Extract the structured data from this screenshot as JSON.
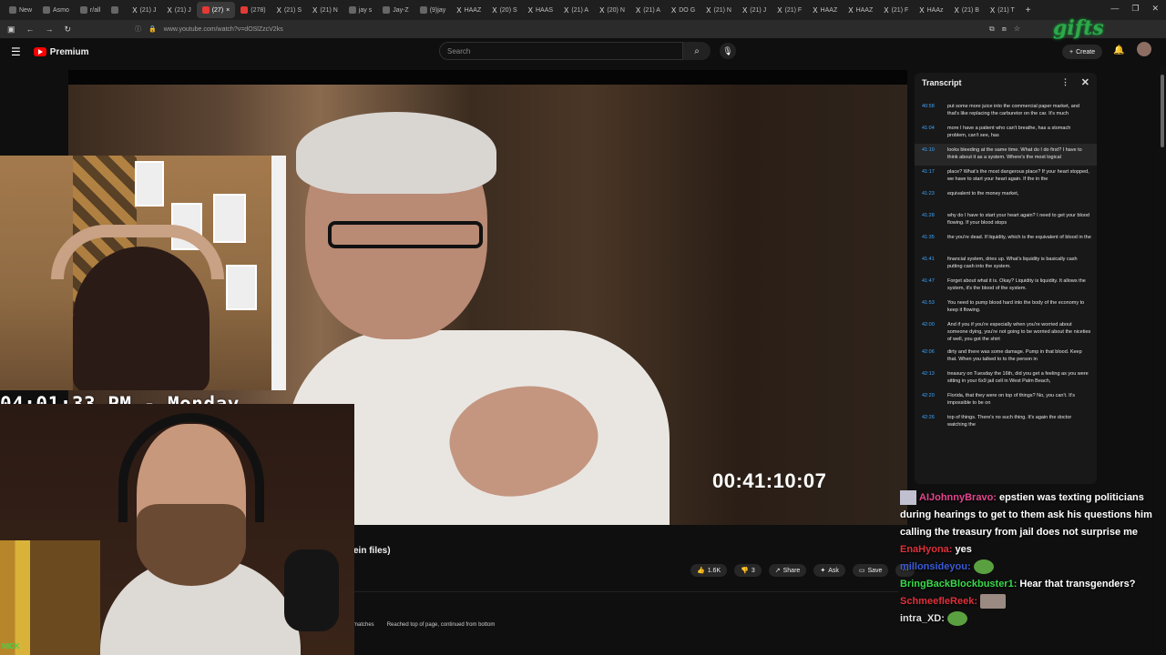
{
  "browser": {
    "tabs": [
      {
        "label": "New",
        "icon": "chrome-icon"
      },
      {
        "label": "Asmo",
        "icon": "reddit-icon"
      },
      {
        "label": "r/all",
        "icon": "reddit-icon"
      },
      {
        "label": "",
        "icon": "page-icon"
      },
      {
        "label": "(21) J",
        "icon": "x-icon"
      },
      {
        "label": "(21) J",
        "icon": "x-icon"
      },
      {
        "label": "(27)",
        "icon": "youtube-icon",
        "active": true
      },
      {
        "label": "(278)",
        "icon": "youtube-icon"
      },
      {
        "label": "(21) S",
        "icon": "x-icon"
      },
      {
        "label": "(21) N",
        "icon": "x-icon"
      },
      {
        "label": "jay s",
        "icon": "google-icon"
      },
      {
        "label": "Jay-Z",
        "icon": "page-icon"
      },
      {
        "label": "(9)jay",
        "icon": "instagram-icon"
      },
      {
        "label": "HAAZ",
        "icon": "x-icon"
      },
      {
        "label": "(20) S",
        "icon": "x-icon"
      },
      {
        "label": "HAAS",
        "icon": "x-icon"
      },
      {
        "label": "(21) A",
        "icon": "x-icon"
      },
      {
        "label": "(20) N",
        "icon": "x-icon"
      },
      {
        "label": "(21) A",
        "icon": "x-icon"
      },
      {
        "label": "DO G",
        "icon": "x-icon"
      },
      {
        "label": "(21) N",
        "icon": "x-icon"
      },
      {
        "label": "(21) J",
        "icon": "x-icon"
      },
      {
        "label": "(21) F",
        "icon": "x-icon"
      },
      {
        "label": "HAAZ",
        "icon": "x-icon"
      },
      {
        "label": "HAAZ",
        "icon": "x-icon"
      },
      {
        "label": "(21) F",
        "icon": "x-icon"
      },
      {
        "label": "HAAz",
        "icon": "x-icon"
      },
      {
        "label": "(21) B",
        "icon": "x-icon"
      },
      {
        "label": "(21) T",
        "icon": "x-icon"
      }
    ],
    "url": "www.youtube.com/watch?v=dOSlZzcV2ks"
  },
  "youtube": {
    "logo_text": "Premium",
    "search_placeholder": "Search",
    "create_label": "Create"
  },
  "video": {
    "timecode": "00:41:10:07",
    "title_fragment": "ein files)",
    "likes": "1.6K",
    "dislikes": "3",
    "share_label": "Share",
    "ask_label": "Ask",
    "save_label": "Save",
    "find_matches": "matches",
    "find_status": "Reached top of page, continued from bottom"
  },
  "transcript": {
    "title": "Transcript",
    "segments": [
      {
        "time": "40:58",
        "text": "put some more juice into the commercial paper market, and that's like replacing the carburetor on the car. It's much"
      },
      {
        "time": "41:04",
        "text": "more I have a patient who can't breathe, has a stomach problem, can't see, has"
      },
      {
        "time": "41:10",
        "text": "looks bleeding at the same time. What do I do first? I have to think about it as a system. Where's the most logical",
        "active": true
      },
      {
        "time": "41:17",
        "text": "place? What's the most dangerous place? If your heart stopped, we have to start your heart again. If the in the"
      },
      {
        "time": "41:23",
        "text": "equivalent to the money market,"
      },
      {
        "time": "41:28",
        "text": "why do I have to start your heart again? I need to get your blood flowing. If your blood stops"
      },
      {
        "time": "41:35",
        "text": "the you're dead. If liquidity, which is the equivalent of blood in the"
      },
      {
        "time": "41:41",
        "text": "financial system, dries up. What's liquidity is basically cash putting cash into the system."
      },
      {
        "time": "41:47",
        "text": "Forget about what it is. Okay? Liquidity is liquidity. It allows the system, it's the blood of the system."
      },
      {
        "time": "41:53",
        "text": "You need to pump blood hard into the body of the economy to keep it flowing."
      },
      {
        "time": "42:00",
        "text": "And if you if you're especially when you're worried about someone dying, you're not going to be worried about the niceties of well, you got the shirt"
      },
      {
        "time": "42:06",
        "text": "dirty and there was some damage. Pump in that blood. Keep that. When you talked to to the person in"
      },
      {
        "time": "42:13",
        "text": "treasury on Tuesday the 16th, did you get a feeling as you were sitting in your 6x9 jail cell in West Palm Beach,"
      },
      {
        "time": "42:20",
        "text": "Florida, that they were on top of things? No, you can't. It's impossible to be on"
      },
      {
        "time": "42:26",
        "text": "top of things. There's no such thing. It's again the doctor watching the"
      }
    ]
  },
  "overlay": {
    "clock": "04:01:33 PM - Monday",
    "cam_tag": "NICK",
    "logo_text": "gifts"
  },
  "chat": [
    {
      "user": "AIJohnnyBravo:",
      "color": "#e5468f",
      "text": "epstien was texting politicians during hearings to get to them ask his questions him calling the treasury from jail does not surprise me",
      "badge": true
    },
    {
      "user": "EnaHyona:",
      "color": "#e0303a",
      "text": "yes"
    },
    {
      "user": "millonsideyou:",
      "color": "#3b5bd6",
      "text": "",
      "emote": "frog-emote"
    },
    {
      "user": "BringBackBlockbuster1:",
      "color": "#3ad84a",
      "text": "Hear that transgenders?"
    },
    {
      "user": "SchmeefleReek:",
      "color": "#e0303a",
      "text": "",
      "emote": "image-emote"
    },
    {
      "user": "intra_XD:",
      "color": "#e0e0e0",
      "text": "",
      "emote": "frog-emote"
    }
  ]
}
